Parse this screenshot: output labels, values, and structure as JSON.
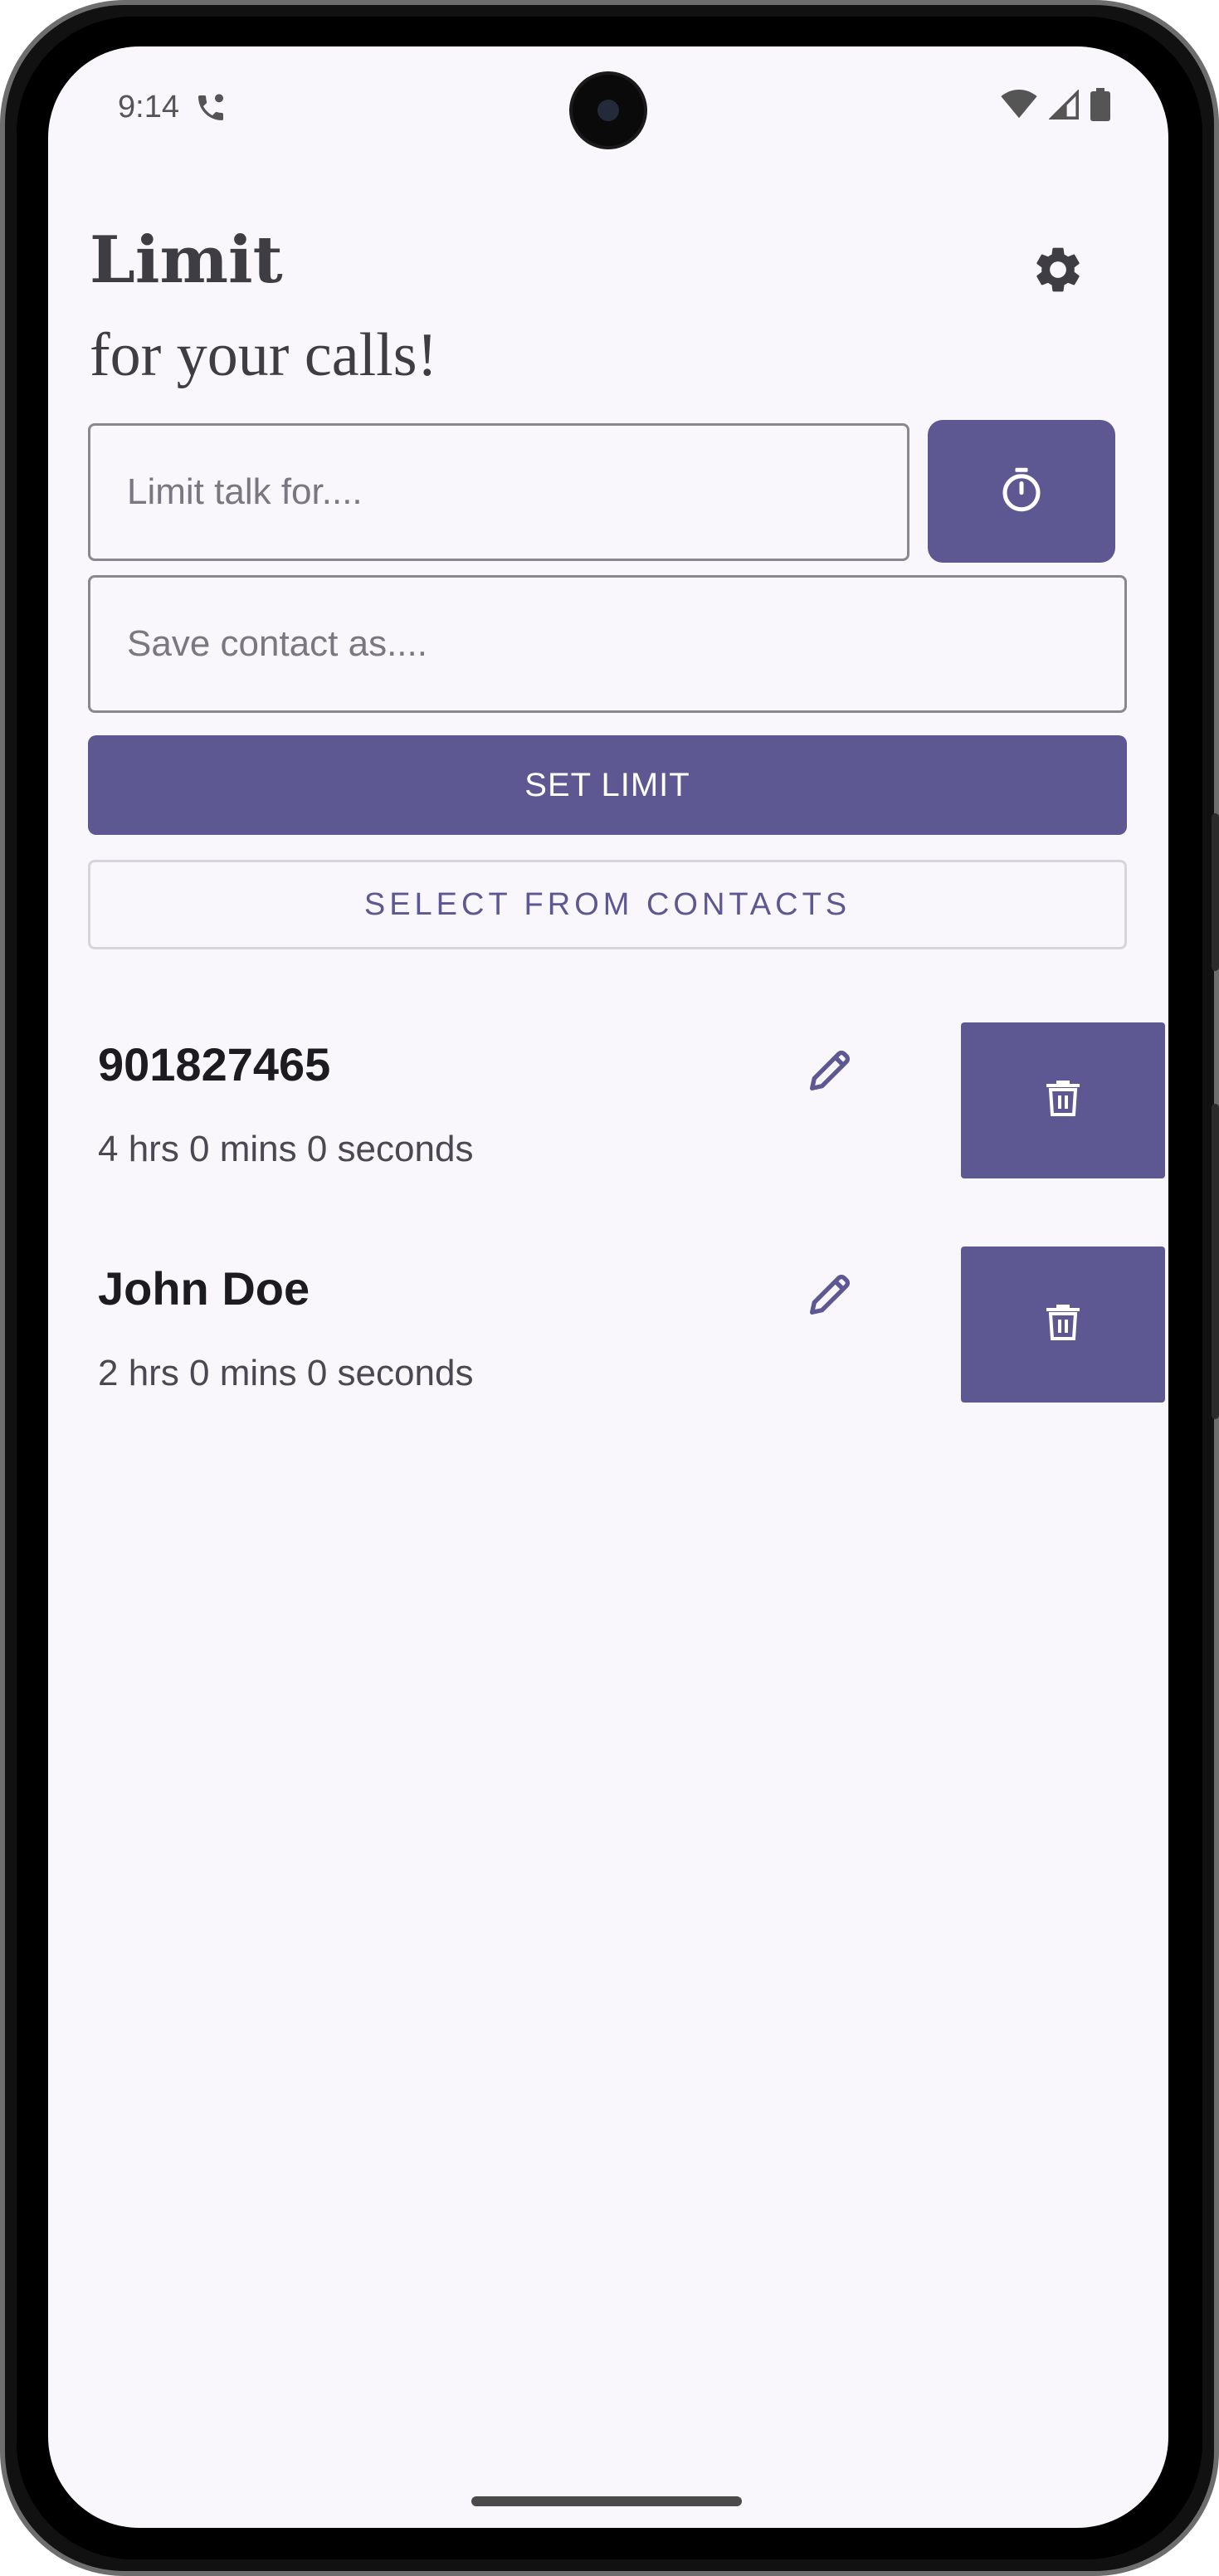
{
  "status_bar": {
    "time": "9:14"
  },
  "header": {
    "title": "Limit",
    "subtitle": "for your calls!"
  },
  "form": {
    "limit_placeholder": "Limit talk for....",
    "contact_placeholder": "Save contact as....",
    "set_limit_label": "SET LIMIT",
    "select_contacts_label": "SELECT FROM CONTACTS"
  },
  "entries": [
    {
      "name": "901827465",
      "duration": "4 hrs 0 mins 0 seconds"
    },
    {
      "name": "John Doe",
      "duration": "2 hrs 0 mins 0 seconds"
    }
  ],
  "icons": {
    "settings": "gear-icon",
    "timer": "stopwatch-icon",
    "edit": "pencil-icon",
    "delete": "trash-icon"
  },
  "colors": {
    "accent": "#5d5891",
    "background": "#f9f6fc",
    "text": "#1c1b1f"
  }
}
